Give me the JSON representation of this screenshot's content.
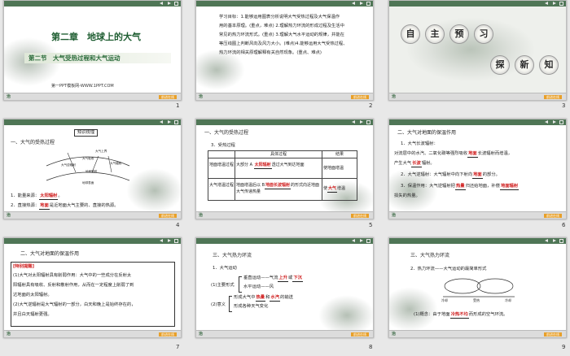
{
  "footer": {
    "logo": "治",
    "badge": "前进在线"
  },
  "slides": [
    {
      "number": "1",
      "chapter": "第二章　地球上的大气",
      "section": "第二节　大气受热过程和大气运动",
      "watermark": "第一PPT模板网-WWW.1PPT.COM"
    },
    {
      "number": "2",
      "lines": [
        "学习目标：1.能够运用图表分析说明大气受热过程及大气保温作",
        "用的基本原理。(重点，难点)  2.理解热力环流的形成过程及生活中",
        "常见的热力环流形式。(重点)  3.理解大气水平运动的规律，并能在",
        "等压线图上判断风向及风力大小。(难点)4.能够运用大气受热过程、",
        "热力环流的相关原理解释有关自然现象。(重点、难点)"
      ]
    },
    {
      "number": "3",
      "circles_top": [
        "自",
        "主",
        "预",
        "习"
      ],
      "circles_bottom": [
        "探",
        "新",
        "知"
      ]
    },
    {
      "number": "4",
      "header": "知识梳理",
      "title": "一、大气的受热过程",
      "diagram": {
        "labels": [
          "大气上界",
          "大气吸收",
          "大气逆辐射",
          "大气辐射",
          "地面辐射",
          "地球表面"
        ]
      },
      "line1_pre": "1．能量来源：",
      "line1_ans": "太阳辐射",
      "line1_post": "。",
      "line2_pre": "2．直接热源：",
      "line2_ans": "地面",
      "line2_post": "是近地面大气主要的、直接的热源。"
    },
    {
      "number": "5",
      "title": "一、大气的受热过程",
      "sub": "3．受热过程",
      "table": {
        "headers": [
          "",
          "具体过程",
          "结果"
        ],
        "rows": [
          {
            "name": "地面增温过程",
            "pre": "大部分 A",
            "ans": "太阳辐射",
            "post": "透过大气到达地面",
            "result": "使地面增温"
          },
          {
            "name": "大气增温过程",
            "pre": "地面增温后以 B",
            "ans": "地面长波辐射",
            "post": "的形式向近地面大气传递热量",
            "result_pre": "使",
            "result_ans": "大气",
            "result_post": "增温"
          }
        ]
      }
    },
    {
      "number": "6",
      "title": "二、大气对地面的保温作用",
      "sub1": "1．大气长波辐射：",
      "l1_pre": "对流层中的水汽、二氧化碳等强烈吸收",
      "l1_ans": "地面",
      "l1_post": "长波辐射而增温，",
      "l2_pre": "产生大气",
      "l2_ans": "长波",
      "l2_post": "辐射。",
      "sub2_pre": "2．大气逆辐射：大气辐射中向下射向",
      "sub2_ans": "地面",
      "sub2_post": "的部分。",
      "sub3_pre": "3．保温作用：大气逆辐射把",
      "sub3_ans": "热量",
      "sub3_mid": "归还给地面，补偿",
      "sub3_ans2": "地面辐射",
      "sub3_post": "损失的热量。"
    },
    {
      "number": "7",
      "title": "二、大气对地面的保温作用",
      "box_title": "[特别提醒]",
      "box_lines": [
        "(1)大气对太阳辐射具有削弱作用：大气中的一些成分在反射太",
        "阳辐射具有吸收、反射和散射作用，从而在一定程度上削弱了到",
        "达地面的太阳辐射。",
        "(2)大气逆辐射是大气辐射的一部分，白天和晚上是始终存在的，",
        "并且白天辐射更强。"
      ]
    },
    {
      "number": "8",
      "title": "三、大气热力环流",
      "sub": "1．大气运动",
      "rows": {
        "l1_label": "(1)主要形式",
        "l1a_pre": "垂直运动——气流",
        "l1a_ans1": "上升",
        "l1a_mid": "或",
        "l1a_ans2": "下沉",
        "l1b": "水平运动——风",
        "l2_label": "(2)意义",
        "l2a_pre": "形成大气中",
        "l2a_ans1": "热量",
        "l2a_mid": "和",
        "l2a_ans2": "水汽",
        "l2a_post": "的输送",
        "l2b": "形成各种天气变化"
      }
    },
    {
      "number": "9",
      "title": "三、大气热力环流",
      "sub": "2．热力环流——大气运动的最简单形式",
      "diagram_labels": [
        "冷却",
        "受热",
        "冷却"
      ],
      "line_pre": "(1)概念：由于地面",
      "line_ans": "冷热不均",
      "line_post": "而形成的空气环流。"
    }
  ]
}
